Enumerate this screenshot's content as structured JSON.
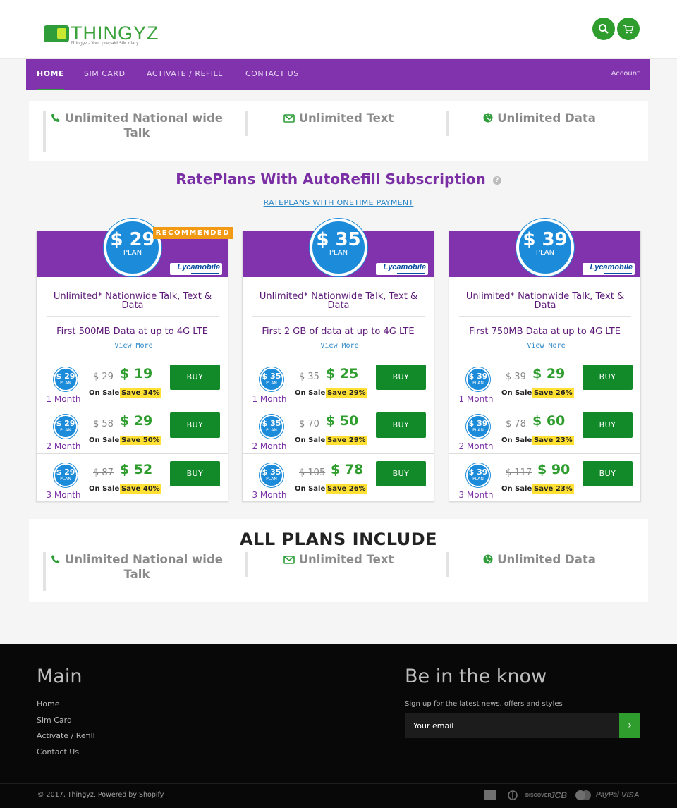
{
  "brand": {
    "name": "THINGYZ",
    "tagline": "Thingyz - Your prepaid SIM diary"
  },
  "nav": {
    "items": [
      "HOME",
      "SIM CARD",
      "ACTIVATE / REFILL",
      "CONTACT US"
    ],
    "account": "Account"
  },
  "features": [
    {
      "icon": "phone-icon",
      "text": "Unlimited National wide Talk"
    },
    {
      "icon": "envelope-icon",
      "text": "Unlimited Text"
    },
    {
      "icon": "globe-icon",
      "text": "Unlimited Data"
    }
  ],
  "section_title": "RatePlans With AutoRefill Subscription",
  "onetime_link": "RATEPLANS WITH ONETIME PAYMENT",
  "plan_label": "PLAN",
  "ribbon": "RECOMMENDED",
  "carrier": "Lycamobile",
  "view_more": "View More",
  "buy_label": "BUY",
  "on_sale": "On Sale",
  "plans": [
    {
      "price": "$ 29",
      "mini": "$ 29",
      "desc": "Unlimited* Nationwide Talk, Text & Data",
      "data": "First 500MB Data at up to 4G LTE",
      "rows": [
        {
          "duration": "1 Month",
          "old": "$ 29",
          "new": "$ 19",
          "save": "Save 34%"
        },
        {
          "duration": "2 Month",
          "old": "$ 58",
          "new": "$ 29",
          "save": "Save 50%"
        },
        {
          "duration": "3 Month",
          "old": "$ 87",
          "new": "$ 52",
          "save": "Save 40%"
        }
      ]
    },
    {
      "price": "$ 35",
      "mini": "$ 35",
      "desc": "Unlimited* Nationwide Talk, Text & Data",
      "data": "First 2 GB of data at up to 4G LTE",
      "rows": [
        {
          "duration": "1 Month",
          "old": "$ 35",
          "new": "$ 25",
          "save": "Save 29%"
        },
        {
          "duration": "2 Month",
          "old": "$ 70",
          "new": "$ 50",
          "save": "Save 29%"
        },
        {
          "duration": "3 Month",
          "old": "$ 105",
          "new": "$ 78",
          "save": "Save 26%"
        }
      ]
    },
    {
      "price": "$ 39",
      "mini": "$ 39",
      "desc": "Unlimited* Nationwide Talk, Text & Data",
      "data": "First 750MB Data at up to 4G LTE",
      "rows": [
        {
          "duration": "1 Month",
          "old": "$ 39",
          "new": "$ 29",
          "save": "Save 26%"
        },
        {
          "duration": "2 Month",
          "old": "$ 78",
          "new": "$ 60",
          "save": "Save 23%"
        },
        {
          "duration": "3 Month",
          "old": "$ 117",
          "new": "$ 90",
          "save": "Save 23%"
        }
      ]
    }
  ],
  "all_plans_title": "ALL PLANS INCLUDE",
  "footer": {
    "main_title": "Main",
    "links": [
      "Home",
      "Sim Card",
      "Activate / Refill",
      "Contact Us"
    ],
    "newsletter_title": "Be in the know",
    "newsletter_sub": "Sign up for the latest news, offers and styles",
    "email_placeholder": "Your email",
    "copyright": "© 2017, Thingyz. Powered by Shopify",
    "payments": [
      "american-express",
      "diners-club",
      "DISCOVER",
      "JCB",
      "master",
      "PayPal",
      "VISA"
    ]
  },
  "colors": {
    "purple": "#8133ad",
    "green": "#2e9d2e",
    "blue": "#1c8bd9",
    "ribbon": "#f29a13"
  }
}
